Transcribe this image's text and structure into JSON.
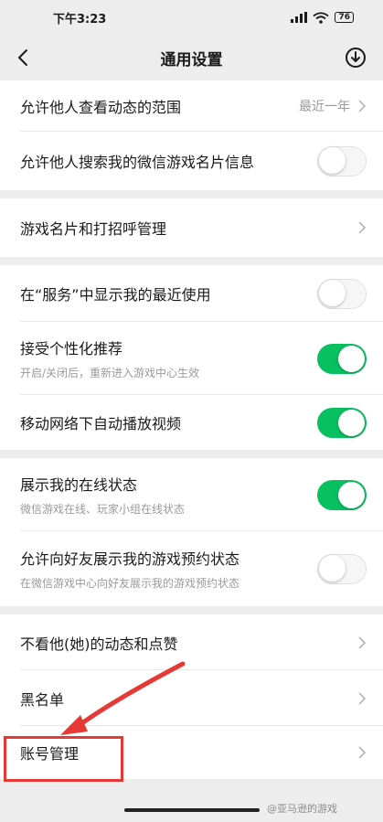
{
  "status_bar": {
    "time": "下午3:23",
    "battery": "76"
  },
  "nav": {
    "title": "通用设置"
  },
  "settings": {
    "moments_range": {
      "title": "允许他人查看动态的范围",
      "value": "最近一年"
    },
    "search_card": {
      "title": "允许他人搜索我的微信游戏名片信息",
      "enabled": false
    },
    "card_greeting": {
      "title": "游戏名片和打招呼管理"
    },
    "recent_use": {
      "title": "在“服务”中显示我的最近使用",
      "enabled": false
    },
    "personalized": {
      "title": "接受个性化推荐",
      "subtitle": "开启/关闭后，重新进入游戏中心生效",
      "enabled": true
    },
    "autoplay": {
      "title": "移动网络下自动播放视频",
      "enabled": true
    },
    "online_status": {
      "title": "展示我的在线状态",
      "subtitle": "微信游戏在线、玩家小组在线状态",
      "enabled": true
    },
    "reservation_status": {
      "title": "允许向好友展示我的游戏预约状态",
      "subtitle": "在微信游戏中心向好友展示我的游戏预约状态",
      "enabled": false
    },
    "hide_moments": {
      "title": "不看他(她)的动态和点赞"
    },
    "blacklist": {
      "title": "黑名单"
    },
    "account": {
      "title": "账号管理"
    }
  },
  "annotation": {
    "color": "#e53935"
  },
  "watermark": "@亚马逊的游戏"
}
